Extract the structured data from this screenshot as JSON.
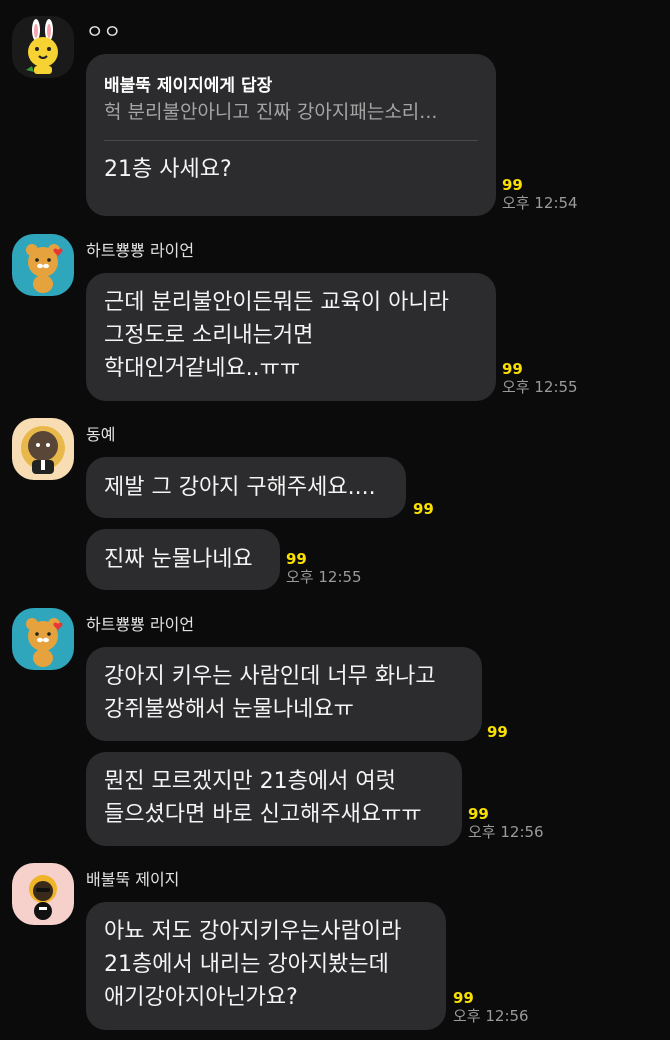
{
  "messages": [
    {
      "sender": "ㅇㅇ",
      "reply": {
        "title": "배불뚝 제이지에게 답장",
        "quote": "헉 분리불안아니고 진짜 강아지패는소리..."
      },
      "bubbles": [
        {
          "text": "21층 사세요?",
          "unread": "99",
          "time": "오후 12:54"
        }
      ]
    },
    {
      "sender": "하트뿅뿅 라이언",
      "bubbles": [
        {
          "text": "근데 분리불안이든뭐든 교육이 아니라\n그정도로 소리내는거면\n학대인거같네요..ㅠㅠ",
          "unread": "99",
          "time": "오후 12:55"
        }
      ]
    },
    {
      "sender": "동예",
      "bubbles": [
        {
          "text": "제발 그 강아지 구해주세요....",
          "unread": "99"
        },
        {
          "text": "진짜 눈물나네요",
          "unread": "99",
          "time": "오후 12:55"
        }
      ]
    },
    {
      "sender": "하트뿅뿅 라이언",
      "bubbles": [
        {
          "text": "강아지 키우는 사람인데 너무 화나고\n강쥐불쌍해서 눈물나네요ㅠ",
          "unread": "99"
        },
        {
          "text": "뭔진 모르겠지만 21층에서 여럿\n들으셨다면 바로 신고해주새요ㅠㅠ",
          "unread": "99",
          "time": "오후 12:56"
        }
      ]
    },
    {
      "sender": "배불뚝 제이지",
      "bubbles": [
        {
          "text": "아뇨 저도 강아지키우는사람이라\n21층에서 내리는 강아지봤는데\n애기강아지아닌가요?",
          "unread": "99",
          "time": "오후 12:56"
        }
      ]
    }
  ],
  "colors": {
    "background": "#0b0b0b",
    "bubble": "#2c2c2e",
    "unread_count": "#f9e000",
    "timestamp": "#9a9a9a"
  },
  "avatars": [
    "muzi-rabbit-avatar",
    "ryan-lion-avatar",
    "neo-cat-avatar",
    "ryan-lion-avatar",
    "jay-g-avatar"
  ]
}
